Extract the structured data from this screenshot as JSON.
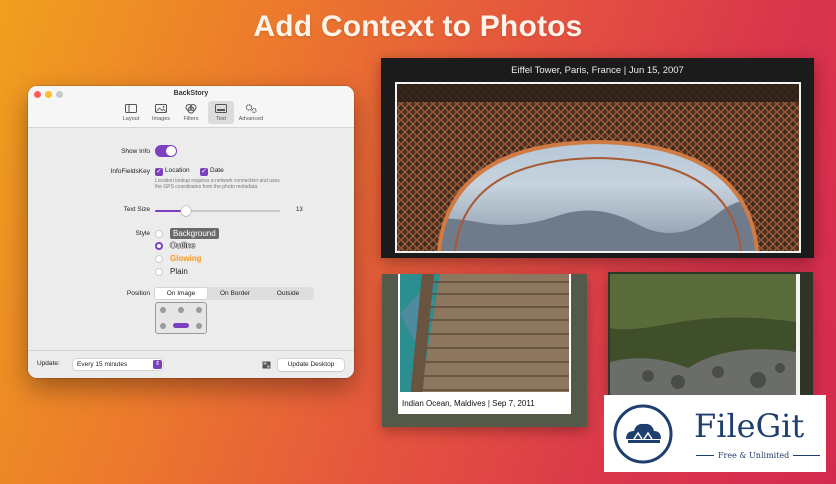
{
  "headline": "Add Context to Photos",
  "window": {
    "title": "BackStory",
    "traffic_colors": [
      "#fe5f57",
      "#febc2e",
      "#c8c8c8"
    ],
    "toolbar": [
      {
        "label": "Layout",
        "icon": "layout-icon"
      },
      {
        "label": "Images",
        "icon": "images-icon"
      },
      {
        "label": "Filters",
        "icon": "filters-icon"
      },
      {
        "label": "Text",
        "icon": "text-icon",
        "active": true
      },
      {
        "label": "Advanced",
        "icon": "gears-icon"
      }
    ],
    "show_info": {
      "label": "Show Info",
      "on": true
    },
    "info_fields": {
      "label": "InfoFieldsKey",
      "location": "Location",
      "date": "Date",
      "note_line1": "Location lookup requires a network connection and uses",
      "note_line2": "the GPS coordinates from the photo metadata."
    },
    "text_size": {
      "label": "Text Size",
      "value": "13",
      "fraction": 0.25
    },
    "style": {
      "label": "Style",
      "options": [
        "Background",
        "Outline",
        "Glowing",
        "Plain"
      ],
      "selected": "Outline"
    },
    "position": {
      "label": "Position",
      "options": [
        "On Image",
        "On Border",
        "Outside"
      ],
      "selected": "On Image"
    },
    "footer": {
      "update_label": "Update:",
      "update_value": "Every 15 minutes",
      "update_desktop": "Update Desktop"
    },
    "accent": "#7b3fbf"
  },
  "photos": {
    "eiffel_caption": "Eiffel Tower, Paris, France  |  Jun 15, 2007",
    "dock_caption": "Indian Ocean, Maldives  |  Sep 7, 2011"
  },
  "badge": {
    "name": "FileGit",
    "tagline": "Free & Unlimited"
  }
}
